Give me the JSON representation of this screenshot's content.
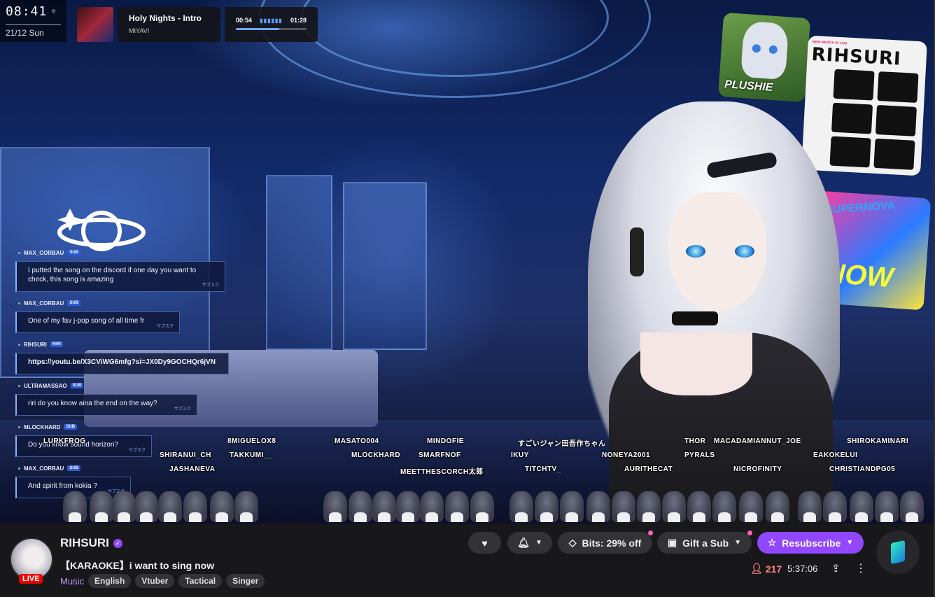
{
  "clock": {
    "time": "08:41",
    "date": "21/12 Sun"
  },
  "now_playing": {
    "title": "Holy Nights - Intro",
    "artist": "MIYAVI",
    "elapsed": "00:54",
    "total": "01:28",
    "progress": 0.61
  },
  "cards": {
    "plush_label": "PLUSHIE",
    "merch_badge": "NEW MERCH IS LIVE",
    "merch_title": "RIHSURI",
    "now_text": "NOW",
    "now_top": "SUPERNOVA"
  },
  "chat": [
    {
      "user": "MAX_CORBAU",
      "badge": "SUB",
      "text": "I putted the song on the discord if one day you want to check, this song is amazing",
      "jp": "サブスク"
    },
    {
      "user": "MAX_CORBAU",
      "badge": "SUB",
      "text": "One of my fav j-pop song of all time fr",
      "jp": "サブスク"
    },
    {
      "user": "RIHSURI",
      "badge": "RIRI",
      "text": "https://youtu.be/X3CViWG6mfg?si=JX0Dy9GOCHQr6jVN",
      "jp": ""
    },
    {
      "user": "ULTRAMASSAO",
      "badge": "SUB",
      "text": "riri do you know aina the end on the way?",
      "jp": "サブスク"
    },
    {
      "user": "MLOCKHARD",
      "badge": "SUB",
      "text": "Do you know sound horizon?",
      "jp": "サブスク"
    },
    {
      "user": "MAX_CORBAU",
      "badge": "SUB",
      "text": "And spirit from kokia ?",
      "jp": "サブスク"
    }
  ],
  "supporters": [
    "LURKFROG",
    "8MIGUELOX8",
    "MASATO004",
    "MINDOFIE",
    "すごいジャン田吾作ちゃん",
    "THOR",
    "MACADAMIANNUT_JOE",
    "SHIROKAMINARI",
    "SHIRANUI_CH",
    "TAKKUMI__",
    "MLOCKHARD",
    "SMARFNOF",
    "IKUY",
    "NONEYA2001",
    "PYRALS",
    "EAKOKELUI",
    "JASHANEVA",
    "MEETTHESCORCH太郎",
    "TITCHTV_",
    "AURITHECAT",
    "NICROFINITY",
    "CHRISTIANDPG05"
  ],
  "channel": {
    "name": "RIHSURI",
    "live_label": "LIVE",
    "title": "【KARAOKE】i want to sing now",
    "category": "Music",
    "tags": [
      "English",
      "Vtuber",
      "Tactical",
      "Singer"
    ]
  },
  "actions": {
    "bits_label": "Bits: 29% off",
    "gift_label": "Gift a Sub",
    "resub_label": "Resubscribe"
  },
  "stats": {
    "viewers": "217",
    "uptime": "5:37:06"
  },
  "colors": {
    "accent": "#9147ff",
    "live": "#eb0400",
    "viewers": "#ff8280",
    "category": "#bf94ff"
  }
}
